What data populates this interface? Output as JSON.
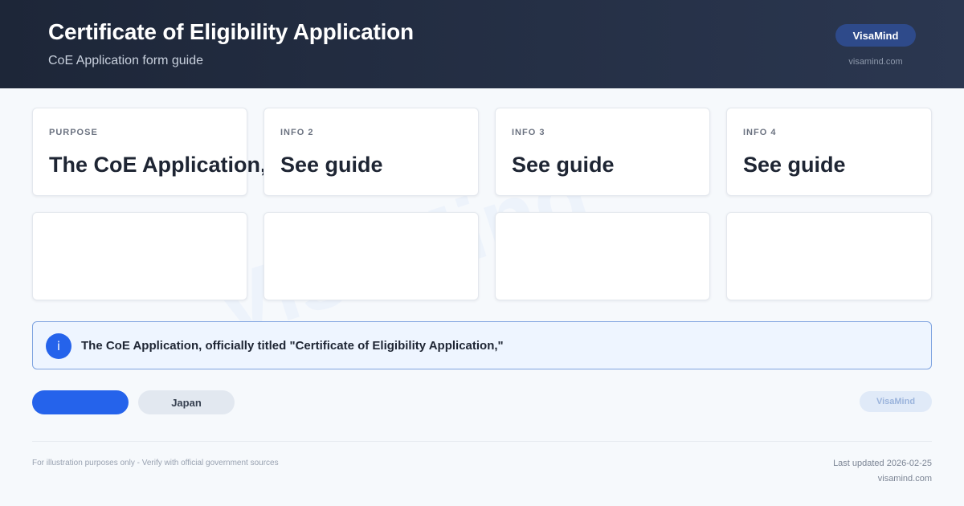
{
  "header": {
    "title": "Certificate of Eligibility Application",
    "subtitle": "CoE Application form guide",
    "brand_label": "VisaMind",
    "brand_url": "visamind.com"
  },
  "cards_top": [
    {
      "label": "PURPOSE",
      "value": "The CoE Application, officially titled"
    },
    {
      "label": "INFO 2",
      "value": "See guide"
    },
    {
      "label": "INFO 3",
      "value": "See guide"
    },
    {
      "label": "INFO 4",
      "value": "See guide"
    }
  ],
  "cards_bottom": [
    {
      "label": "",
      "value": ""
    },
    {
      "label": "",
      "value": ""
    },
    {
      "label": "",
      "value": ""
    },
    {
      "label": "",
      "value": ""
    }
  ],
  "info": {
    "icon": "info-icon",
    "text": "The CoE Application, officially titled \"Certificate of Eligibility Application,\""
  },
  "actions": {
    "primary_label": "",
    "secondary_label": "Japan",
    "brand_label": "VisaMind"
  },
  "footer": {
    "disclaimer": "For illustration purposes only - Verify with official government sources",
    "last_updated": "Last updated 2026-02-25",
    "url": "visamind.com"
  },
  "colors": {
    "header_bg": "#1d2638",
    "accent": "#2563eb",
    "info_bg": "#eef5ff",
    "info_border": "#7ea3e0"
  }
}
